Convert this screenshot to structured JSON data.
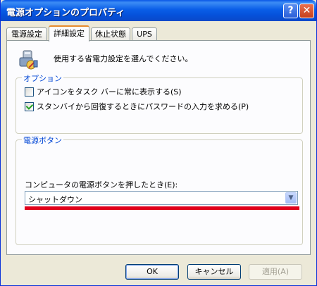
{
  "window": {
    "title": "電源オプションのプロパティ",
    "help_label": "?",
    "close_label": "✕"
  },
  "tabs": [
    {
      "label": "電源設定",
      "active": false
    },
    {
      "label": "詳細設定",
      "active": true
    },
    {
      "label": "休止状態",
      "active": false
    },
    {
      "label": "UPS",
      "active": false
    }
  ],
  "header": {
    "icon": "power-settings-icon",
    "text": "使用する省電力設定を選んでください。"
  },
  "options_group": {
    "title": "オプション",
    "items": [
      {
        "label": "アイコンをタスク バーに常に表示する(S)",
        "checked": false
      },
      {
        "label": "スタンバイから回復するときにパスワードの入力を求める(P)",
        "checked": true
      }
    ]
  },
  "power_button_group": {
    "title": "電源ボタン",
    "combo_label": "コンピュータの電源ボタンを押したとき(E):",
    "combo_value": "シャットダウン"
  },
  "buttons": {
    "ok": "OK",
    "cancel": "キャンセル",
    "apply": "適用(A)"
  },
  "colors": {
    "title_bar": "#0a5ee8",
    "group_title": "#0046d5",
    "highlight_line": "#e0001b"
  }
}
